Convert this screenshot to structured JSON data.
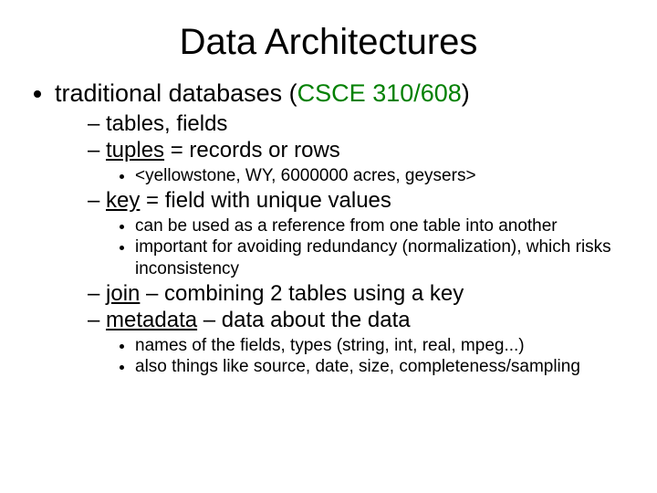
{
  "title": "Data Architectures",
  "b1_pre": "traditional databases (",
  "b1_green": "CSCE 310/608",
  "b1_post": ")",
  "s1": "tables, fields",
  "s2a": "tuples",
  "s2b": " = records or rows",
  "s2_1": "<yellowstone, WY, 6000000 acres, geysers>",
  "s3a": "key",
  "s3b": " = field with unique values",
  "s3_1": "can be used as a reference from one table into another",
  "s3_2": "important for avoiding redundancy (normalization), which risks inconsistency",
  "s4a": "join",
  "s4b": " – combining 2 tables using a key",
  "s5a": "metadata",
  "s5b": " – data about the data",
  "s5_1": "names of the fields, types (string, int, real, mpeg...)",
  "s5_2": "also things like source, date, size, completeness/sampling"
}
